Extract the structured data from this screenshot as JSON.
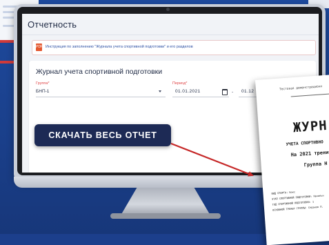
{
  "screen": {
    "page_title": "Отчетность",
    "notice_icon": "pdf-icon",
    "notice_icon_text": "PDF",
    "notice_text": "Инструкция по заполнению \"Журнала учета спортивной подготовки\" и его разделов",
    "card": {
      "title": "Журнал учета спортивной подготовки",
      "group_label": "Группа*",
      "group_value": "БНП-1",
      "period_label": "Период*",
      "date_from": "01.01.2021",
      "dash": "-",
      "date_to": "01.12"
    },
    "download_button": "СКАЧАТЬ ВЕСЬ ОТЧЕТ"
  },
  "document": {
    "watermark": "Тестовая демонстрационн",
    "title": "ЖУРН",
    "subtitle_1": "УЧЕТА СПОРТИВНО",
    "subtitle_2": "На 2021 тренир",
    "subtitle_3": "Группа Н",
    "meta_lines": [
      "ВИД СПОРТА: Бокс",
      "ЭТАП СПОРТИВНОЙ ПОДГОТОВКИ: Начальн",
      "ГОД СПОРТИВНОЙ ПОДГОТОВКИ: 1",
      "ОСНОВНОЙ ТРЕНЕР ГРУППЫ: Седанов П."
    ]
  },
  "colors": {
    "background": "#1c3f8c",
    "button": "#1d2a55",
    "arrow": "#c62828",
    "required_label": "#e0484a",
    "link": "#2a4fa3"
  }
}
